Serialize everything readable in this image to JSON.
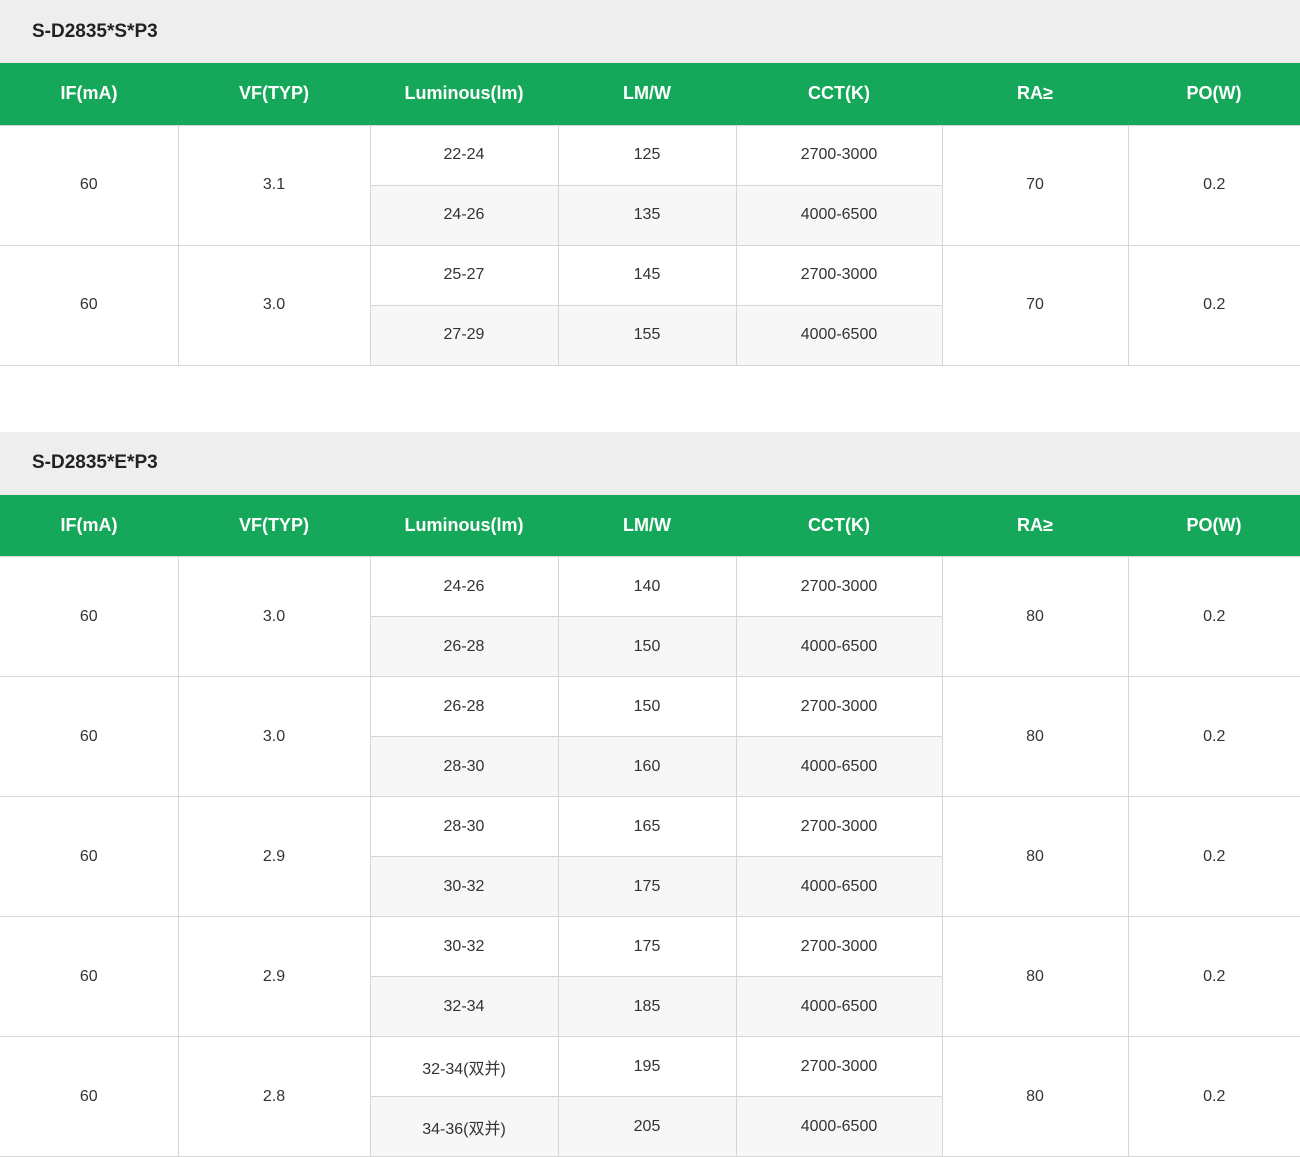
{
  "headers": [
    "IF(mA)",
    "VF(TYP)",
    "Luminous(lm)",
    "LM/W",
    "CCT(K)",
    "RA≥",
    "PO(W)"
  ],
  "sections": [
    {
      "title": "S-D2835*S*P3",
      "groups": [
        {
          "if": "60",
          "vf": "3.1",
          "ra": "70",
          "po": "0.2",
          "rows": [
            {
              "lm": "22-24",
              "lmw": "125",
              "cct": "2700-3000"
            },
            {
              "lm": "24-26",
              "lmw": "135",
              "cct": "4000-6500"
            }
          ]
        },
        {
          "if": "60",
          "vf": "3.0",
          "ra": "70",
          "po": "0.2",
          "rows": [
            {
              "lm": "25-27",
              "lmw": "145",
              "cct": "2700-3000"
            },
            {
              "lm": "27-29",
              "lmw": "155",
              "cct": "4000-6500"
            }
          ]
        }
      ]
    },
    {
      "title": "S-D2835*E*P3",
      "groups": [
        {
          "if": "60",
          "vf": "3.0",
          "ra": "80",
          "po": "0.2",
          "rows": [
            {
              "lm": "24-26",
              "lmw": "140",
              "cct": "2700-3000"
            },
            {
              "lm": "26-28",
              "lmw": "150",
              "cct": "4000-6500"
            }
          ]
        },
        {
          "if": "60",
          "vf": "3.0",
          "ra": "80",
          "po": "0.2",
          "rows": [
            {
              "lm": "26-28",
              "lmw": "150",
              "cct": "2700-3000"
            },
            {
              "lm": "28-30",
              "lmw": "160",
              "cct": "4000-6500"
            }
          ]
        },
        {
          "if": "60",
          "vf": "2.9",
          "ra": "80",
          "po": "0.2",
          "rows": [
            {
              "lm": "28-30",
              "lmw": "165",
              "cct": "2700-3000"
            },
            {
              "lm": "30-32",
              "lmw": "175",
              "cct": "4000-6500"
            }
          ]
        },
        {
          "if": "60",
          "vf": "2.9",
          "ra": "80",
          "po": "0.2",
          "rows": [
            {
              "lm": "30-32",
              "lmw": "175",
              "cct": "2700-3000"
            },
            {
              "lm": "32-34",
              "lmw": "185",
              "cct": "4000-6500"
            }
          ]
        },
        {
          "if": "60",
          "vf": "2.8",
          "ra": "80",
          "po": "0.2",
          "rows": [
            {
              "lm": "32-34(双并)",
              "lmw": "195",
              "cct": "2700-3000"
            },
            {
              "lm": "34-36(双并)",
              "lmw": "205",
              "cct": "4000-6500"
            }
          ]
        }
      ]
    }
  ],
  "colors": {
    "header_green": "#16a85a",
    "title_bar": "#eeeeee",
    "alt_row": "#f7f7f7"
  }
}
